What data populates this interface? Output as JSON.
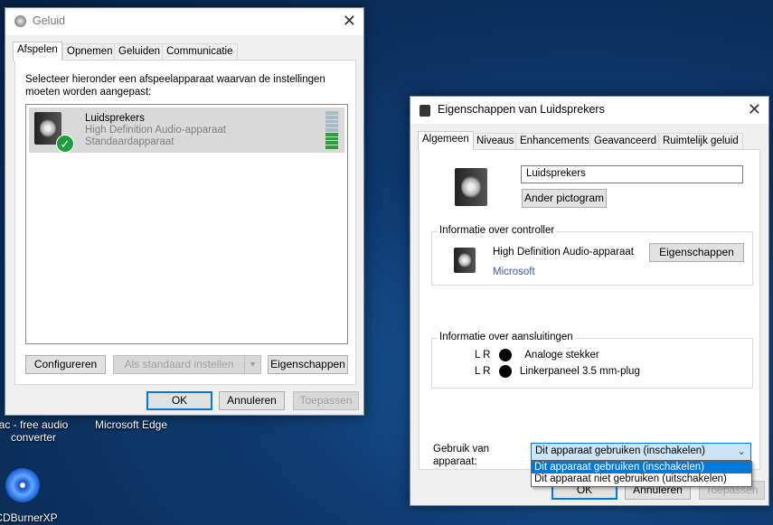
{
  "desktop": {
    "icons": [
      {
        "label": "ac - free audio\nconverter"
      },
      {
        "label": "Microsoft Edge"
      },
      {
        "label": "CDBurnerXP"
      }
    ]
  },
  "sound_window": {
    "title": "Geluid",
    "tabs": [
      "Afspelen",
      "Opnemen",
      "Geluiden",
      "Communicatie"
    ],
    "active_tab": "Afspelen",
    "instruction": "Selecteer hieronder een afspeelapparaat waarvan de instellingen moeten worden aangepast:",
    "devices": [
      {
        "name": "Luidsprekers",
        "description": "High Definition Audio-apparaat",
        "status": "Standaardapparaat",
        "level_bars_active": 4,
        "level_bars_total": 9
      }
    ],
    "buttons": {
      "configure": "Configureren",
      "set_default": "Als standaard instellen",
      "properties": "Eigenschappen"
    },
    "footer": {
      "ok": "OK",
      "cancel": "Annuleren",
      "apply": "Toepassen"
    }
  },
  "properties_window": {
    "title": "Eigenschappen van Luidsprekers",
    "tabs": [
      "Algemeen",
      "Niveaus",
      "Enhancements",
      "Geavanceerd",
      "Ruimtelijk geluid"
    ],
    "active_tab": "Algemeen",
    "name_value": "Luidsprekers",
    "change_icon": "Ander pictogram",
    "controller": {
      "legend": "Informatie over controller",
      "name": "High Definition Audio-apparaat",
      "vendor": "Microsoft",
      "properties_button": "Eigenschappen"
    },
    "jacks": {
      "legend": "Informatie over aansluitingen",
      "items": [
        {
          "channels": "L R",
          "name": "Analoge stekker"
        },
        {
          "channels": "L R",
          "name": "Linkerpaneel 3.5 mm-plug"
        }
      ]
    },
    "usage": {
      "label": "Gebruik van\napparaat:",
      "selected": "Dit apparaat gebruiken (inschakelen)",
      "options": [
        "Dit apparaat gebruiken (inschakelen)",
        "Dit apparaat niet gebruiken (uitschakelen)"
      ]
    },
    "footer": {
      "ok": "OK",
      "cancel": "Annuleren",
      "apply": "Toepassen"
    }
  },
  "colors": {
    "accent": "#0078d7",
    "link": "#3b5ba5",
    "check": "#1e9e3e"
  }
}
